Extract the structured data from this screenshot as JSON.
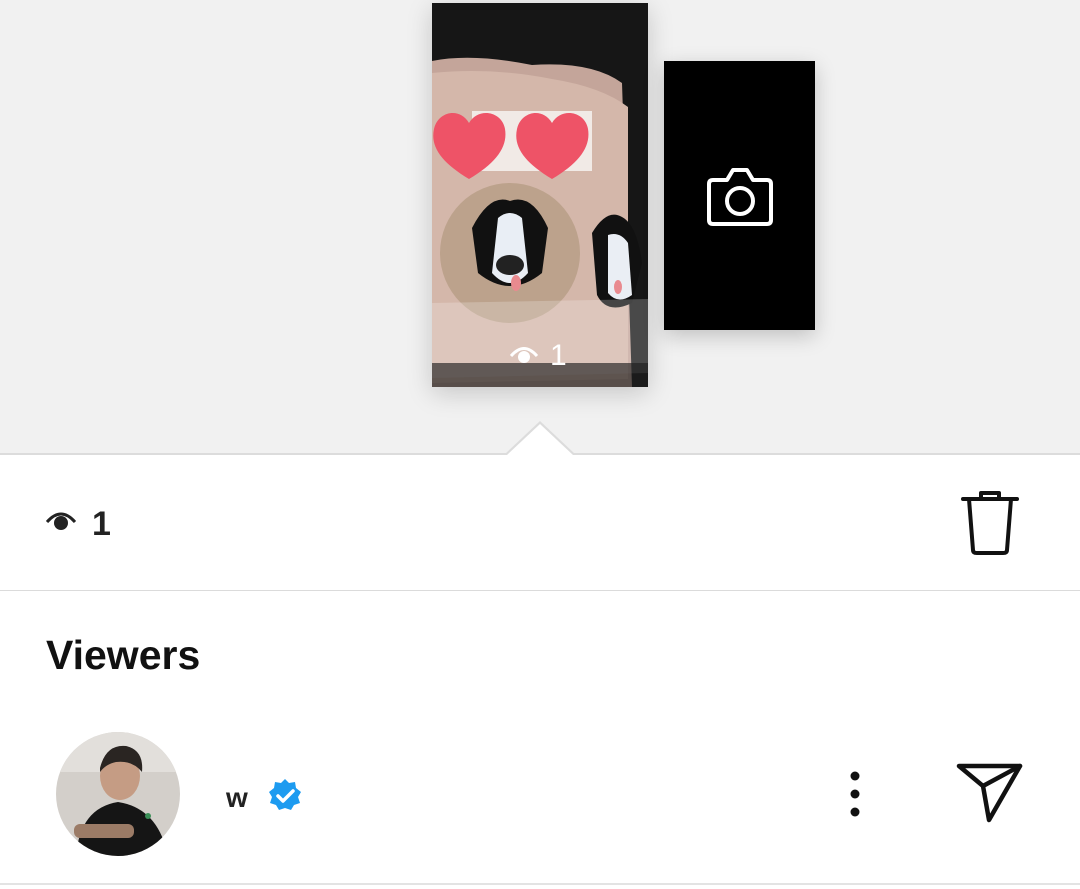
{
  "story": {
    "thumbnail_view_count": "1",
    "icons": {
      "hearts": "heart-icon",
      "eye": "eye-icon",
      "camera": "camera-icon"
    }
  },
  "stats": {
    "view_count": "1"
  },
  "viewers": {
    "title": "Viewers",
    "items": [
      {
        "username": "w",
        "verified": true
      }
    ]
  },
  "colors": {
    "verified_blue": "#1d9bf0",
    "heart_red": "#ee5367"
  }
}
